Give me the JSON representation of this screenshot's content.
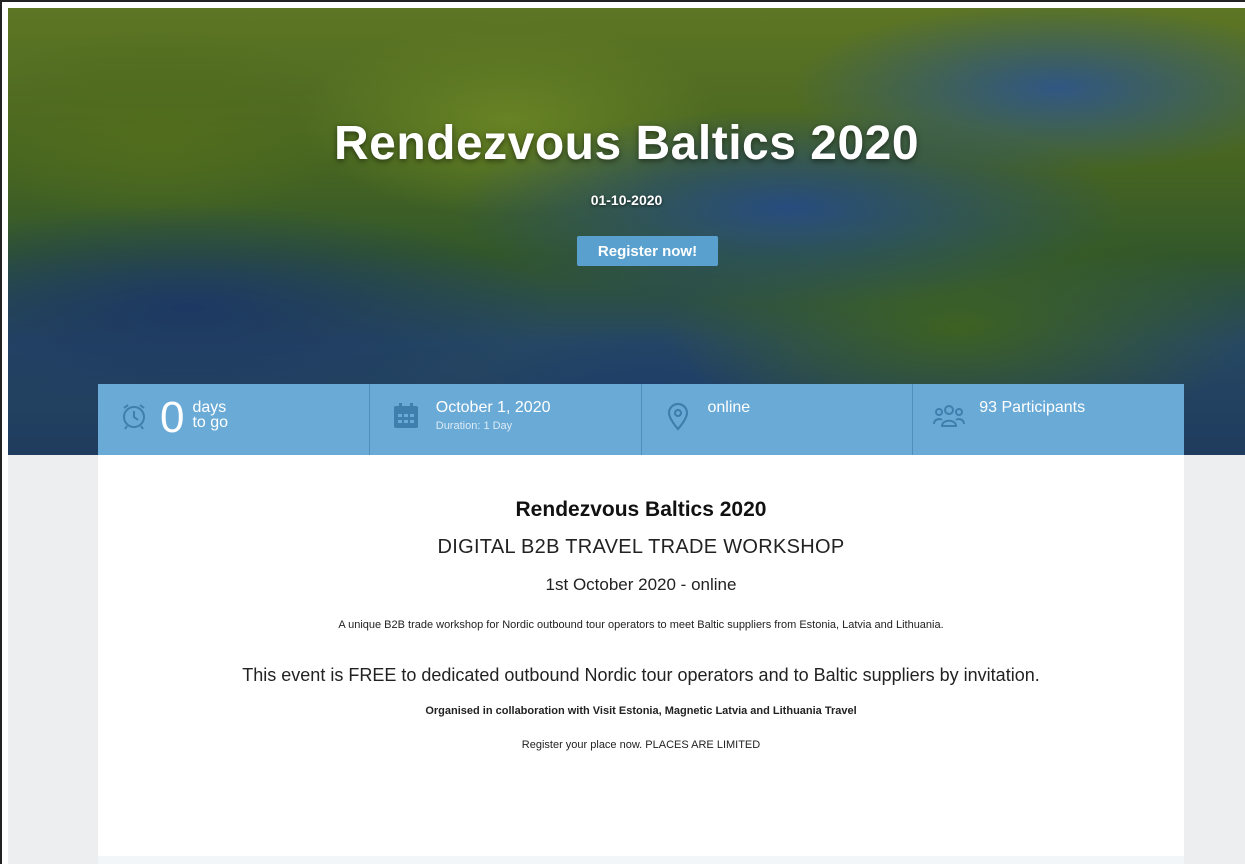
{
  "hero": {
    "title": "Rendezvous Baltics 2020",
    "date": "01-10-2020",
    "register_label": "Register now!"
  },
  "info_bar": {
    "countdown": {
      "number": "0",
      "unit_line1": "days",
      "unit_line2": "to go",
      "icon": "alarm-clock-icon"
    },
    "date": {
      "main": "October 1, 2020",
      "sub": "Duration: 1 Day",
      "icon": "calendar-icon"
    },
    "location": {
      "main": "online",
      "icon": "location-pin-icon"
    },
    "participants": {
      "main": "93 Participants",
      "icon": "people-icon"
    }
  },
  "content": {
    "title": "Rendezvous Baltics 2020",
    "subtitle": "DIGITAL B2B TRAVEL TRADE WORKSHOP",
    "date_line": "1st October 2020 - online",
    "description": "A unique B2B trade workshop for Nordic outbound tour operators to meet Baltic suppliers from Estonia, Latvia and Lithuania.",
    "free_notice": "This event is FREE to dedicated outbound Nordic tour operators and to Baltic suppliers by invitation.",
    "organised": "Organised in collaboration with Visit Estonia, Magnetic Latvia and Lithuania Travel",
    "register_note": "Register your place now. PLACES ARE LIMITED"
  },
  "colors": {
    "accent": "#6aaad6",
    "button": "#5aa0cf"
  }
}
